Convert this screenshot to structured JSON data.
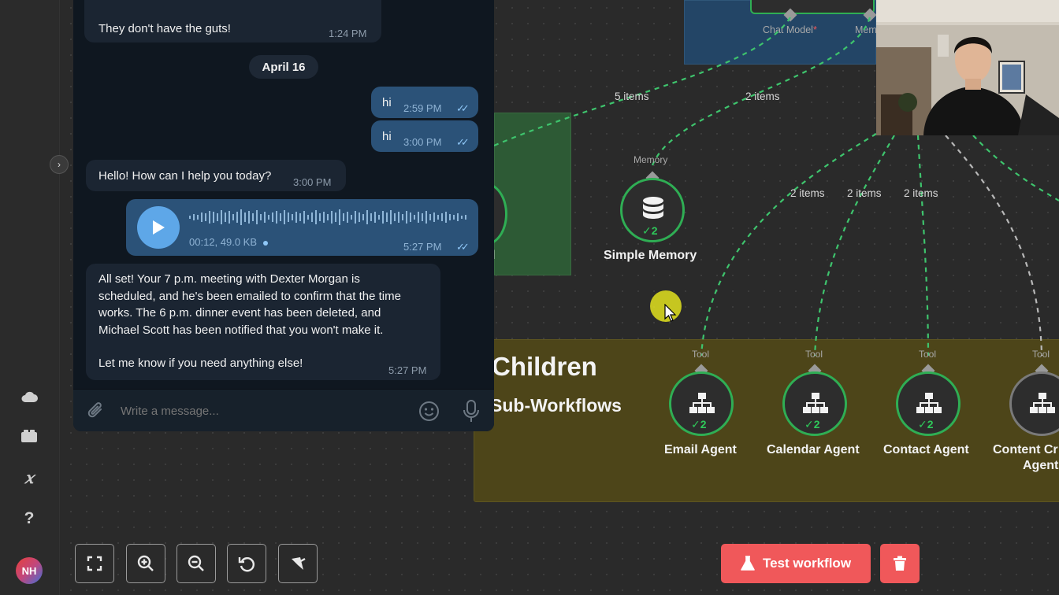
{
  "chat": {
    "messages": {
      "m1": {
        "text": "They don't have the guts!",
        "time": "1:24 PM"
      },
      "date_separator": "April 16",
      "m2": {
        "text": "hi",
        "time": "2:59 PM"
      },
      "m3": {
        "text": "hi",
        "time": "3:00 PM"
      },
      "m4": {
        "text": "Hello! How can I help you today?",
        "time": "3:00 PM"
      },
      "voice": {
        "meta": "00:12, 49.0 KB",
        "time": "5:27 PM"
      },
      "m5": {
        "line1": "All set! Your 7 p.m. meeting with Dexter Morgan is",
        "line2": "scheduled, and he's been emailed to confirm that the time",
        "line3": "works. The 6 p.m. dinner event has been deleted, and",
        "line4": "Michael Scott has been notified that you won't make it.",
        "line5": "Let me know if you need anything else!",
        "time": "5:27 PM"
      }
    },
    "composer": {
      "placeholder": "Write a message..."
    }
  },
  "canvas": {
    "top_node": {
      "chat_model_label": "Chat Model",
      "required_mark": "*",
      "memory_label": "Mem"
    },
    "edges": {
      "e1": "5 items",
      "e2": "2 items",
      "e3": "2 items",
      "e4": "2 items",
      "e5": "2 items"
    },
    "memory_node": {
      "handle_label": "Memory",
      "name": "Simple Memory",
      "count": "2"
    },
    "group": {
      "title": "Children",
      "subtitle": "Sub-Workflows"
    },
    "green_group_fragment": "l",
    "agents": {
      "email": {
        "handle": "Tool",
        "name": "Email Agent",
        "count": "2"
      },
      "calendar": {
        "handle": "Tool",
        "name": "Calendar Agent",
        "count": "2"
      },
      "contact": {
        "handle": "Tool",
        "name": "Contact Agent",
        "count": "2"
      },
      "content": {
        "handle": "Tool",
        "name_line1": "Content Cr",
        "name_line2": "Agent"
      }
    }
  },
  "sidebar": {
    "avatar_initials": "NH"
  },
  "toolbar": {
    "test_workflow_label": "Test workflow"
  },
  "colors": {
    "accent_red": "#f0585a",
    "success_green": "#2fae54",
    "telegram_outgoing": "#2b5278",
    "telegram_incoming": "#1b2532",
    "children_group": "#4d4519"
  }
}
